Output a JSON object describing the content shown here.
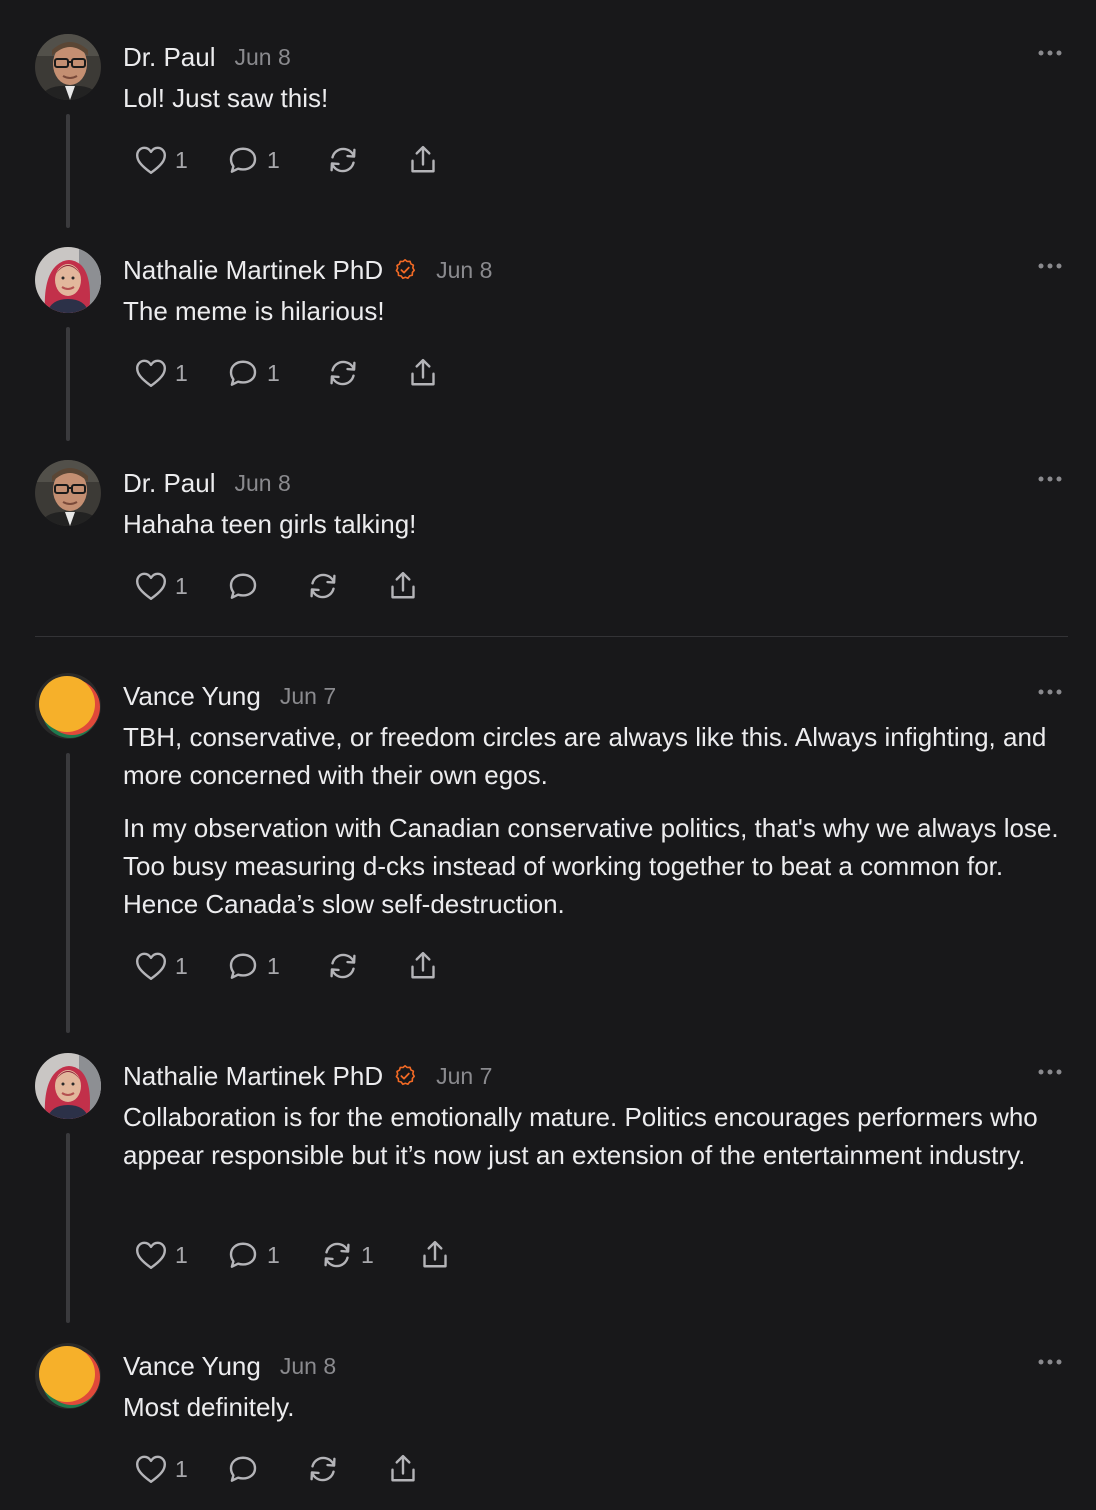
{
  "colors": {
    "background": "#18181a",
    "text": "#ececee",
    "muted": "#8a8a8e",
    "verified_badge": "#f26a25",
    "thread_line": "#3a3a3d"
  },
  "posts": [
    {
      "author": "Dr. Paul",
      "date": "Jun 8",
      "verified": false,
      "avatar_icon": "portrait-man-glasses",
      "paragraphs": [
        "Lol! Just saw this!"
      ],
      "like_count": "1",
      "comment_count": "1",
      "restack_count": ""
    },
    {
      "author": "Nathalie Martinek PhD",
      "date": "Jun 8",
      "verified": true,
      "avatar_icon": "portrait-woman",
      "paragraphs": [
        "The meme is hilarious!"
      ],
      "like_count": "1",
      "comment_count": "1",
      "restack_count": ""
    },
    {
      "author": "Dr. Paul",
      "date": "Jun 8",
      "verified": false,
      "avatar_icon": "portrait-man-glasses",
      "paragraphs": [
        "Hahaha teen girls talking!"
      ],
      "like_count": "1",
      "comment_count": "",
      "restack_count": ""
    },
    {
      "author": "Vance Yung",
      "date": "Jun 7",
      "verified": false,
      "avatar_icon": "orange-circle-logo",
      "paragraphs": [
        "TBH, conservative, or freedom circles are always like this. Always infighting, and more concerned with their own egos.",
        "In my observation with Canadian conservative politics, that's why we always lose. Too busy measuring d-cks instead of working together to beat a common for. Hence Canada’s slow self-destruction."
      ],
      "like_count": "1",
      "comment_count": "1",
      "restack_count": ""
    },
    {
      "author": "Nathalie Martinek PhD",
      "date": "Jun 7",
      "verified": true,
      "avatar_icon": "portrait-woman",
      "paragraphs": [
        "Collaboration is for the emotionally mature. Politics encourages performers who appear responsible but it’s now just an extension of the entertainment industry."
      ],
      "like_count": "1",
      "comment_count": "1",
      "restack_count": "1"
    },
    {
      "author": "Vance Yung",
      "date": "Jun 8",
      "verified": false,
      "avatar_icon": "orange-circle-logo",
      "paragraphs": [
        "Most definitely."
      ],
      "like_count": "1",
      "comment_count": "",
      "restack_count": ""
    }
  ]
}
